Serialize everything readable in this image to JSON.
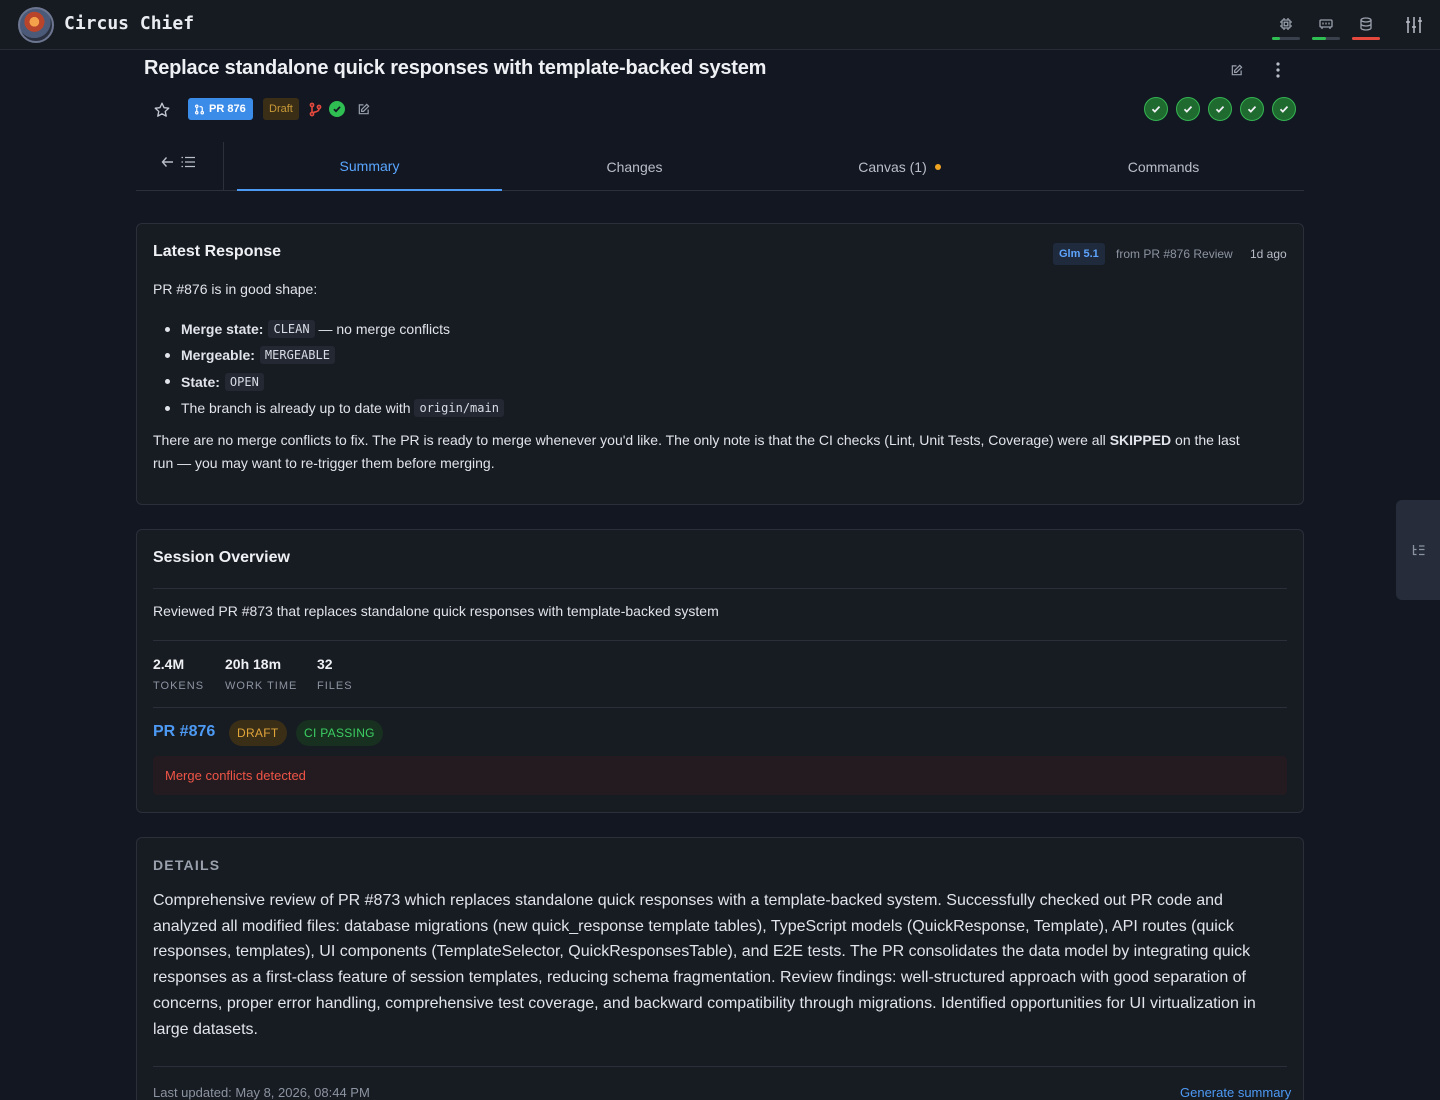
{
  "app": {
    "title": "Circus Chief"
  },
  "topbar": {
    "icons": [
      {
        "name": "cpu-icon",
        "level": 0.3,
        "color": "#2fbe52"
      },
      {
        "name": "memory-icon",
        "level": 0.5,
        "color": "#2fbe52"
      },
      {
        "name": "disk-icon",
        "level": 1.0,
        "color": "#e5493d"
      },
      {
        "name": "settings-sliders-icon"
      }
    ]
  },
  "page": {
    "title": "Replace standalone quick responses with template-backed system",
    "pr_label": "PR 876",
    "draft_label": "Draft",
    "checks_count": 5
  },
  "tabs": [
    {
      "label": "Summary",
      "active": true
    },
    {
      "label": "Changes"
    },
    {
      "label": "Canvas (1)"
    },
    {
      "label": "Commands"
    }
  ],
  "latest_response": {
    "title": "Latest Response",
    "model": "Glm 5.1",
    "source": "from PR #876 Review",
    "time": "1d ago",
    "intro": "PR #876 is in good shape:",
    "bullets": [
      {
        "label": "Merge state:",
        "code": "CLEAN",
        "suffix": "— no merge conflicts"
      },
      {
        "label": "Mergeable:",
        "code": "MERGEABLE"
      },
      {
        "label": "State:",
        "code": "OPEN"
      },
      {
        "text": "The branch is already up to date with",
        "code": "origin/main"
      }
    ],
    "para_before": "There are no merge conflicts to fix. The PR is ready to merge whenever you'd like. The only note is that the CI checks (Lint, Unit Tests, Coverage) were all",
    "para_bold": "SKIPPED",
    "para_after1": "on the last",
    "para_after2": "run — you may want to re-trigger them before merging."
  },
  "session": {
    "title": "Session Overview",
    "summary": "Reviewed PR #873 that replaces standalone quick responses with template-backed system",
    "stats": [
      {
        "value": "2.4M",
        "label": "TOKENS"
      },
      {
        "value": "20h 18m",
        "label": "WORK TIME"
      },
      {
        "value": "32",
        "label": "FILES"
      }
    ],
    "pr_link": "PR #876",
    "draft_pill": "DRAFT",
    "ci_pill": "CI PASSING",
    "warning": "Merge conflicts detected"
  },
  "details": {
    "title": "DETAILS",
    "body": "Comprehensive review of PR #873 which replaces standalone quick responses with a template-backed system. Successfully checked out PR code and analyzed all modified files: database migrations (new quick_response template tables), TypeScript models (QuickResponse, Template), API routes (quick responses, templates), UI components (TemplateSelector, QuickResponsesTable), and E2E tests. The PR consolidates the data model by integrating quick responses as a first-class feature of session templates, reducing schema fragmentation. Review findings: well-structured approach with good separation of concerns, proper error handling, comprehensive test coverage, and backward compatibility through migrations. Identified opportunities for UI virtualization in large datasets.",
    "last_updated": "Last updated: May 8, 2026, 08:44 PM",
    "generate_label": "Generate summary"
  }
}
